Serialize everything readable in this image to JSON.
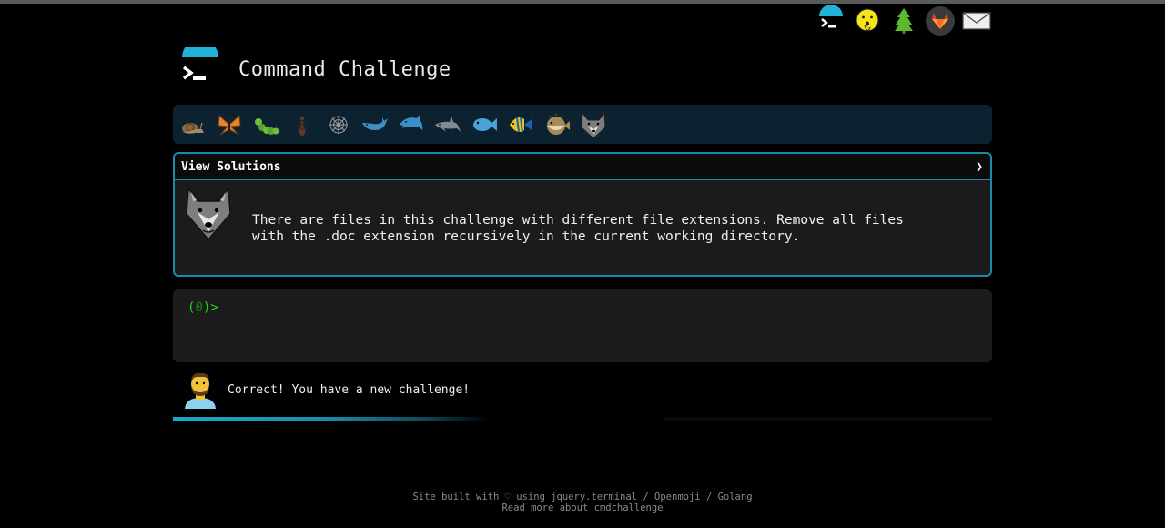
{
  "app": {
    "title": "Command Challenge"
  },
  "topnav": {
    "icons": [
      "terminal-icon",
      "hushed-face-icon",
      "tree-icon",
      "gitlab-icon",
      "envelope-icon"
    ]
  },
  "levels": [
    "snail",
    "butterfly",
    "caterpillar",
    "ant",
    "spider-web",
    "whale",
    "dolphin",
    "shark",
    "fish",
    "tropical-fish",
    "blowfish",
    "wolf"
  ],
  "challenge": {
    "solutions_label": "View Solutions",
    "expand_glyph": "❯",
    "description": "There are files in this challenge with different file extensions. Remove all files\nwith the .doc extension recursively in the current working directory."
  },
  "terminal": {
    "prompt_open": "(",
    "count": "0",
    "prompt_close": ")>"
  },
  "feedback": {
    "message": "Correct! You have a new challenge!"
  },
  "progress": {
    "fraction": 0.6
  },
  "footer": {
    "line1_prefix": "Site built with",
    "heart": "♡",
    "line1_using": "using",
    "link_terminal": "jquery.terminal",
    "sep1": "/",
    "link_openmoji": "Openmoji",
    "sep2": "/",
    "link_golang": "Golang",
    "line2": "Read more about cmdchallenge"
  },
  "colors": {
    "accent": "#1b8aa8",
    "prompt": "#22d422",
    "level_bar": "#0c2230"
  }
}
